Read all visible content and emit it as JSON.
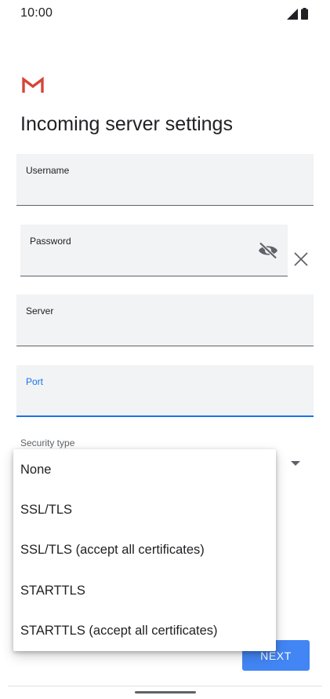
{
  "status_bar": {
    "time": "10:00"
  },
  "header": {
    "logo_icon": "gmail-m-icon",
    "title": "Incoming server settings"
  },
  "form": {
    "username": {
      "label": "Username",
      "value": ""
    },
    "password": {
      "label": "Password",
      "value": ""
    },
    "server": {
      "label": "Server",
      "value": ""
    },
    "port": {
      "label": "Port",
      "value": ""
    },
    "security_type": {
      "label": "Security type"
    }
  },
  "security_menu": {
    "options": [
      "None",
      "SSL/TLS",
      "SSL/TLS (accept all certificates)",
      "STARTTLS",
      "STARTTLS (accept all certificates)"
    ]
  },
  "footer": {
    "next_label": "NEXT"
  },
  "colors": {
    "accent": "#1a73e8",
    "button": "#4285f4",
    "field_bg": "#f1f3f4",
    "logo_red": "#d44638"
  }
}
